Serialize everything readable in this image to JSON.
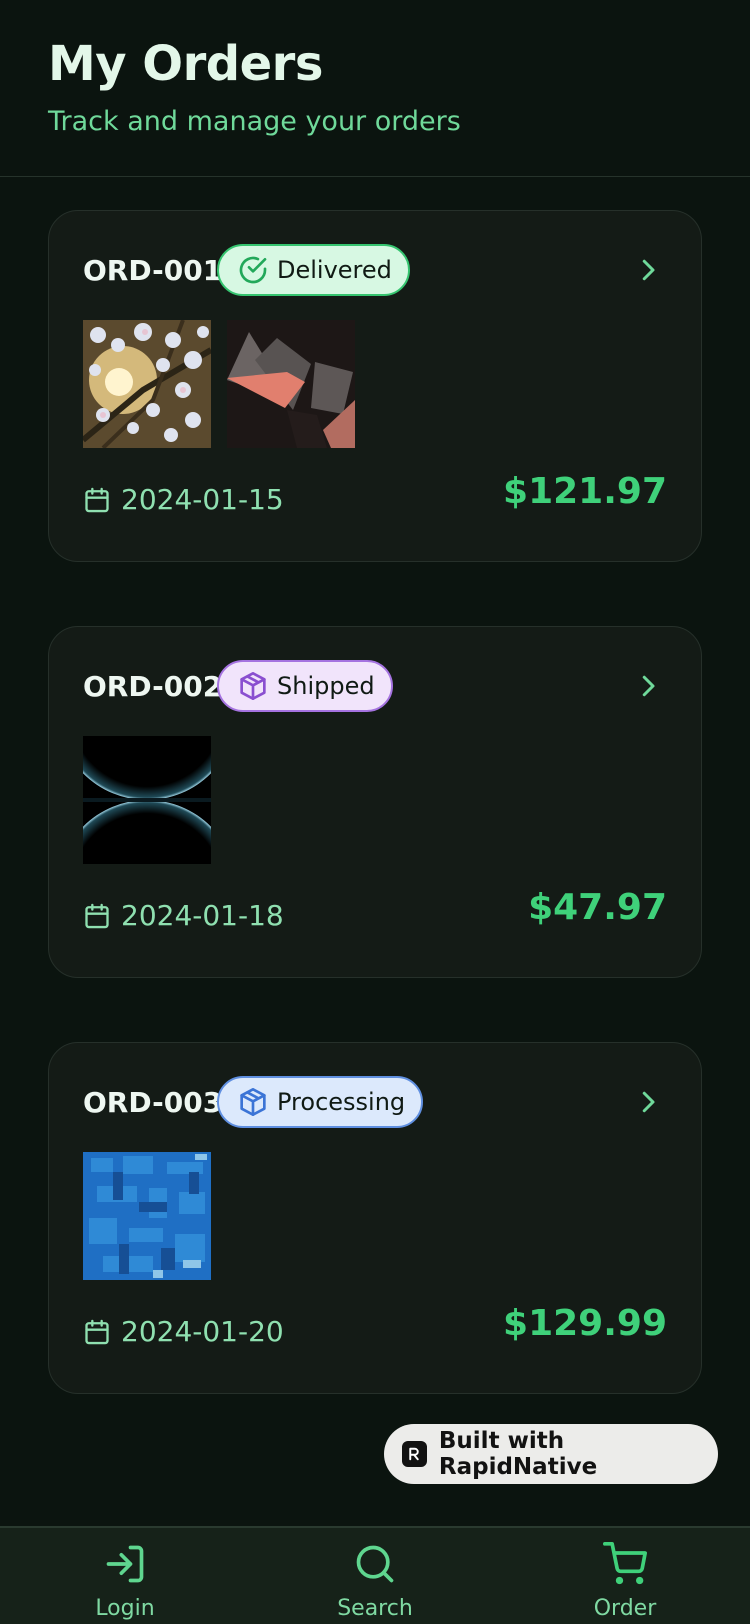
{
  "header": {
    "title": "My Orders",
    "subtitle": "Track and manage your orders"
  },
  "orders": [
    {
      "id": "ORD-001",
      "status": "Delivered",
      "status_icon": "check-circle-icon",
      "date": "2024-01-15",
      "total": "$121.97",
      "thumbnails": [
        "blossom-branch-image",
        "abstract-cubes-image"
      ]
    },
    {
      "id": "ORD-002",
      "status": "Shipped",
      "status_icon": "package-icon",
      "date": "2024-01-18",
      "total": "$47.97",
      "thumbnails": [
        "dark-spheres-image"
      ]
    },
    {
      "id": "ORD-003",
      "status": "Processing",
      "status_icon": "package-icon",
      "date": "2024-01-20",
      "total": "$129.99",
      "thumbnails": [
        "blue-pattern-image"
      ]
    }
  ],
  "badge": {
    "label": "Built with RapidNative"
  },
  "tabs": [
    {
      "label": "Login",
      "icon": "login-icon"
    },
    {
      "label": "Search",
      "icon": "search-icon"
    },
    {
      "label": "Order",
      "icon": "cart-icon"
    }
  ],
  "colors": {
    "background": "#0b140f",
    "card": "#141b16",
    "accent": "#3fd17a",
    "delivered": "#35c46f",
    "shipped": "#a573e0",
    "processing": "#5f8fe0"
  }
}
